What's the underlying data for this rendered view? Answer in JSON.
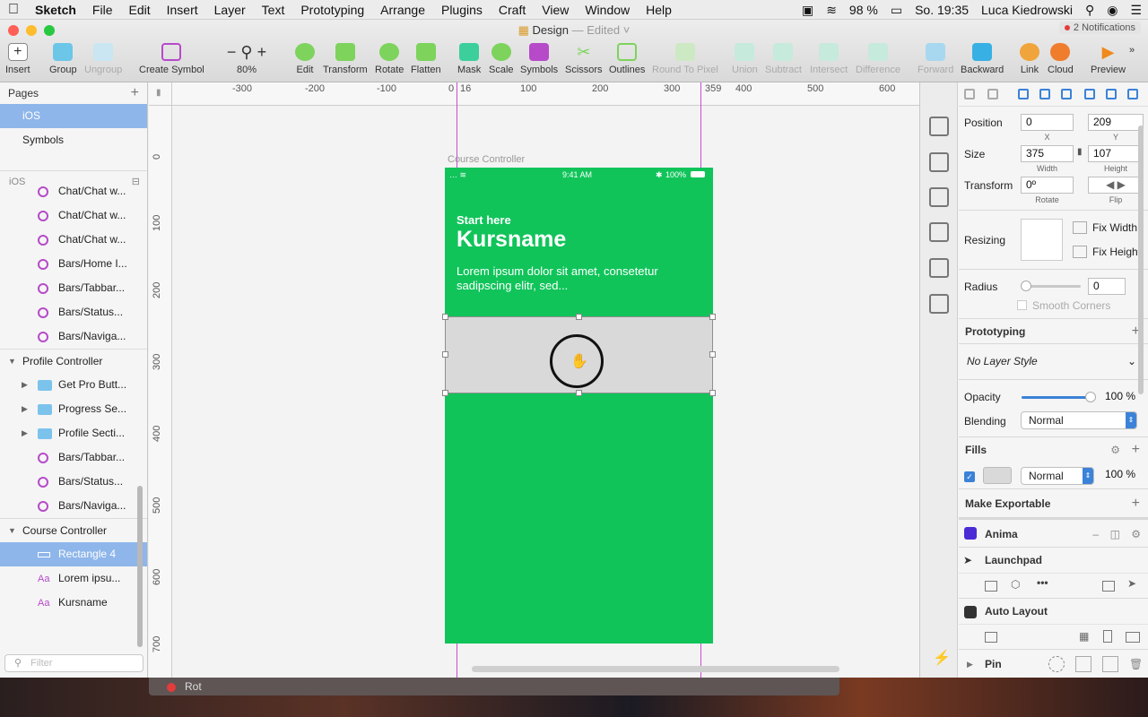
{
  "menubar": {
    "app": "Sketch",
    "items": [
      "File",
      "Edit",
      "Insert",
      "Layer",
      "Text",
      "Prototyping",
      "Arrange",
      "Plugins",
      "Craft",
      "View",
      "Window",
      "Help"
    ],
    "battery": "98 %",
    "time": "So. 19:35",
    "user": "Luca Kiedrowski"
  },
  "window": {
    "title": "Design",
    "status": "Edited",
    "notifications": "2 Notifications",
    "colors": {
      "close": "#fe5f57",
      "minimize": "#febc2e",
      "zoom": "#28c840"
    }
  },
  "toolbar": {
    "insert": "Insert",
    "group": "Group",
    "ungroup": "Ungroup",
    "create_symbol": "Create Symbol",
    "zoom": "80%",
    "edit": "Edit",
    "transform": "Transform",
    "rotate": "Rotate",
    "flatten": "Flatten",
    "mask": "Mask",
    "scale": "Scale",
    "symbols": "Symbols",
    "scissors": "Scissors",
    "outlines": "Outlines",
    "round": "Round To Pixel",
    "union": "Union",
    "subtract": "Subtract",
    "intersect": "Intersect",
    "difference": "Difference",
    "forward": "Forward",
    "backward": "Backward",
    "link": "Link",
    "cloud": "Cloud",
    "preview": "Preview"
  },
  "pages": {
    "header": "Pages",
    "items": [
      "iOS",
      "Symbols"
    ],
    "section": "iOS"
  },
  "layers": [
    {
      "name": "Chat/Chat w...",
      "icon": "symbol-icon",
      "indent": 2
    },
    {
      "name": "Chat/Chat w...",
      "icon": "symbol-icon",
      "indent": 2
    },
    {
      "name": "Chat/Chat w...",
      "icon": "symbol-icon",
      "indent": 2
    },
    {
      "name": "Bars/Home I...",
      "icon": "symbol-icon",
      "indent": 2
    },
    {
      "name": "Bars/Tabbar...",
      "icon": "symbol-icon",
      "indent": 2
    },
    {
      "name": "Bars/Status...",
      "icon": "symbol-icon",
      "indent": 2
    },
    {
      "name": "Bars/Naviga...",
      "icon": "symbol-icon",
      "indent": 2
    },
    {
      "name": "Profile Controller",
      "icon": "artboard",
      "indent": 0
    },
    {
      "name": "Get Pro Butt...",
      "icon": "folder-icon",
      "indent": 1
    },
    {
      "name": "Progress Se...",
      "icon": "folder-icon",
      "indent": 1
    },
    {
      "name": "Profile Secti...",
      "icon": "folder-icon",
      "indent": 1
    },
    {
      "name": "Bars/Tabbar...",
      "icon": "symbol-icon",
      "indent": 2
    },
    {
      "name": "Bars/Status...",
      "icon": "symbol-icon",
      "indent": 2
    },
    {
      "name": "Bars/Naviga...",
      "icon": "symbol-icon",
      "indent": 2
    },
    {
      "name": "Course Controller",
      "icon": "artboard",
      "indent": 0
    },
    {
      "name": "Rectangle 4",
      "icon": "rectangle-icon",
      "indent": 2,
      "selected": true
    },
    {
      "name": "Lorem ipsu...",
      "icon": "text-icon",
      "indent": 2
    },
    {
      "name": "Kursname",
      "icon": "text-icon",
      "indent": 2
    }
  ],
  "filter_placeholder": "Filter",
  "ruler": {
    "h": [
      "-300",
      "-200",
      "-100",
      "0",
      "16",
      "100",
      "200",
      "300",
      "359",
      "400",
      "500",
      "600"
    ],
    "v": [
      "0",
      "100",
      "200",
      "300",
      "400",
      "500",
      "600",
      "700"
    ]
  },
  "canvas": {
    "artboard_label": "Course Controller",
    "status_time": "9:41 AM",
    "status_battery": "100%",
    "start": "Start here",
    "title": "Kursname",
    "body": "Lorem ipsum dolor sit amet, consetetur sadipscing elitr, sed...",
    "artboard_color": "#10c45a",
    "rect_color": "#d9d9d9",
    "dock_label": "Rot"
  },
  "inspector": {
    "position": "Position",
    "x": "0",
    "y": "209",
    "x_label": "X",
    "y_label": "Y",
    "size": "Size",
    "width": "375",
    "height": "107",
    "width_label": "Width",
    "height_label": "Height",
    "transform": "Transform",
    "rotate": "0º",
    "rotate_label": "Rotate",
    "flip_label": "Flip",
    "resizing": "Resizing",
    "fix_width": "Fix Width",
    "fix_height": "Fix Height",
    "radius": "Radius",
    "radius_value": "0",
    "smooth": "Smooth Corners",
    "prototyping": "Prototyping",
    "layer_style": "No Layer Style",
    "opacity": "Opacity",
    "opacity_value": "100 %",
    "opacity_fraction": 1.0,
    "blending": "Blending",
    "blending_value": "Normal",
    "fills": "Fills",
    "fill_blend": "Normal",
    "fill_opacity": "100 %",
    "exportable": "Make Exportable",
    "anima": "Anima",
    "launchpad": "Launchpad",
    "autolayout": "Auto Layout",
    "pin": "Pin"
  },
  "accent": "#3b82d8"
}
